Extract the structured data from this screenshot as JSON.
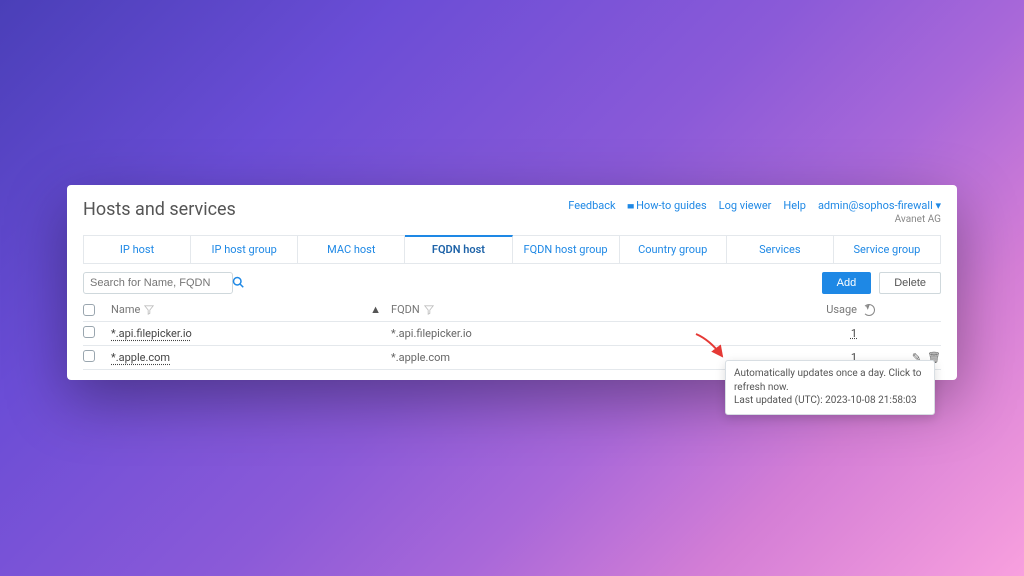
{
  "page": {
    "title": "Hosts and services",
    "org": "Avanet AG"
  },
  "headerLinks": {
    "feedback": "Feedback",
    "howto": "How-to guides",
    "logviewer": "Log viewer",
    "help": "Help",
    "user": "admin@sophos-firewall"
  },
  "tabs": [
    "IP host",
    "IP host group",
    "MAC host",
    "FQDN host",
    "FQDN host group",
    "Country group",
    "Services",
    "Service group"
  ],
  "activeTab": 3,
  "search": {
    "placeholder": "Search for Name, FQDN"
  },
  "buttons": {
    "add": "Add",
    "delete": "Delete"
  },
  "columns": {
    "name": "Name",
    "fqdn": "FQDN",
    "usage": "Usage"
  },
  "rows": [
    {
      "name": "*.api.filepicker.io",
      "fqdn": "*.api.filepicker.io",
      "usage": "1"
    },
    {
      "name": "*.apple.com",
      "fqdn": "*.apple.com",
      "usage": "1"
    }
  ],
  "tooltip": {
    "line1": "Automatically updates once a day. Click to refresh now.",
    "line2": "Last updated (UTC): 2023-10-08 21:58:03"
  }
}
